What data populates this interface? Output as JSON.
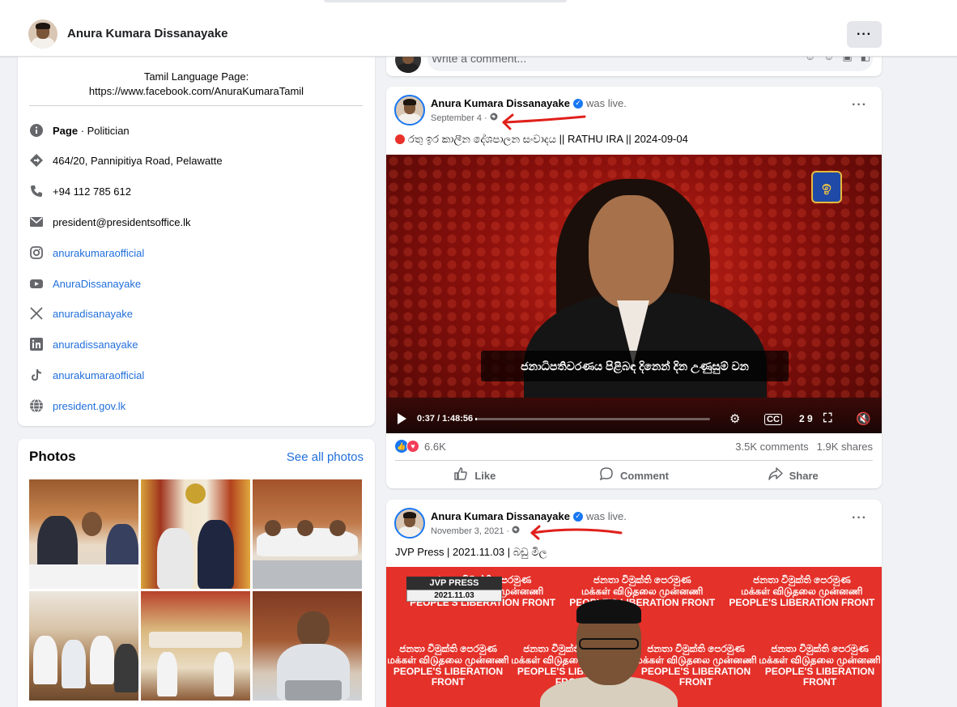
{
  "header": {
    "page_name": "Anura Kumara Dissanayake",
    "more_label": "···"
  },
  "intro": {
    "tamil_title": "Tamil Language Page:",
    "tamil_link": "https://www.facebook.com/AnuraKumaraTamil",
    "rows": [
      {
        "icon": "info-icon",
        "label_bold": "Page",
        "label": " · Politician"
      },
      {
        "icon": "location-icon",
        "label": "464/20, Pannipitiya Road, Pelawatte"
      },
      {
        "icon": "phone-icon",
        "label": "+94 112 785 612"
      },
      {
        "icon": "email-icon",
        "label": "president@presidentsoffice.lk"
      },
      {
        "icon": "instagram-icon",
        "label": "anurakumaraofficial"
      },
      {
        "icon": "youtube-icon",
        "label": "AnuraDissanayake"
      },
      {
        "icon": "x-icon",
        "label": "anuradisanayake"
      },
      {
        "icon": "linkedin-icon",
        "label": "anuradissanayake"
      },
      {
        "icon": "tiktok-icon",
        "label": "anurakumaraofficial"
      },
      {
        "icon": "globe-icon",
        "label": "president.gov.lk"
      }
    ]
  },
  "photos": {
    "title": "Photos",
    "see_all": "See all photos"
  },
  "comment_box": {
    "placeholder": "Write a comment..."
  },
  "posts": [
    {
      "author": "Anura Kumara Dissanayake",
      "status": "was live.",
      "date": "September 4",
      "text": "රතු ඉර කාලීන දේශපාලන සංවාදය || RATHU IRA || 2024-09-04",
      "video": {
        "caption": "ජනාධිපතිවරණය පිළිබඳ දිනෙන් දින උණුසුම් වන",
        "time": "0:37 / 1:48:56",
        "progress": 0.006,
        "cc_label": "CC",
        "quality_label": "2 9"
      },
      "reactions_count": "6.6K",
      "comments_count": "3.5K comments",
      "shares_count": "1.9K shares",
      "actions": {
        "like": "Like",
        "comment": "Comment",
        "share": "Share"
      }
    },
    {
      "author": "Anura Kumara Dissanayake",
      "status": "was live.",
      "date": "November 3, 2021",
      "text": "JVP Press | 2021.11.03 | බඩු මිල",
      "video": {
        "tag_title": "JVP PRESS",
        "tag_date": "2021.11.03",
        "banner_si": "ජනතා විමුක්ති පෙරමුණ",
        "banner_ta": "மக்கள் விடுதலை முன்னணி",
        "banner_en": "PEOPLE'S LIBERATION FRONT"
      }
    }
  ],
  "colors": {
    "accent": "#1877f2",
    "link": "#216fdb",
    "annotation_red": "#e0201b",
    "background": "#f0f2f5"
  }
}
